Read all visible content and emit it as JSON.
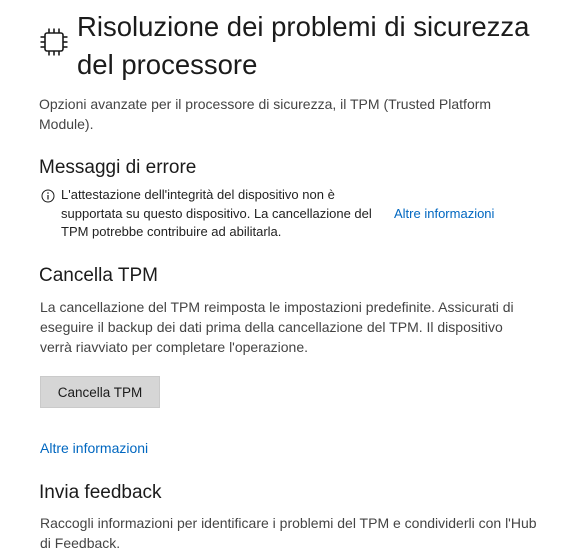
{
  "page": {
    "title": "Risoluzione dei problemi di sicurezza del processore",
    "icon": "processor-chip-icon",
    "intro": "Opzioni avanzate per il processore di sicurezza, il TPM (Trusted Platform Module)."
  },
  "errors": {
    "heading": "Messaggi di errore",
    "icon": "info-icon",
    "message": "L'attestazione dell'integrità del dispositivo non è supportata su questo dispositivo. La cancellazione del TPM potrebbe contribuire ad abilitarla.",
    "more_info_link": "Altre informazioni"
  },
  "clear_tpm": {
    "heading": "Cancella TPM",
    "description": "La cancellazione del TPM reimposta le impostazioni predefinite. Assicurati di eseguire il backup dei dati prima della cancellazione del TPM. Il dispositivo verrà riavviato per completare l'operazione.",
    "button_label": "Cancella TPM",
    "more_info_link": "Altre informazioni"
  },
  "feedback": {
    "heading": "Invia feedback",
    "description": "Raccogli informazioni per identificare i problemi del TPM e condividerli con l'Hub di Feedback."
  },
  "colors": {
    "link": "#0067c0",
    "button_bg": "#d6d6d6",
    "text": "#1b1b1b"
  }
}
